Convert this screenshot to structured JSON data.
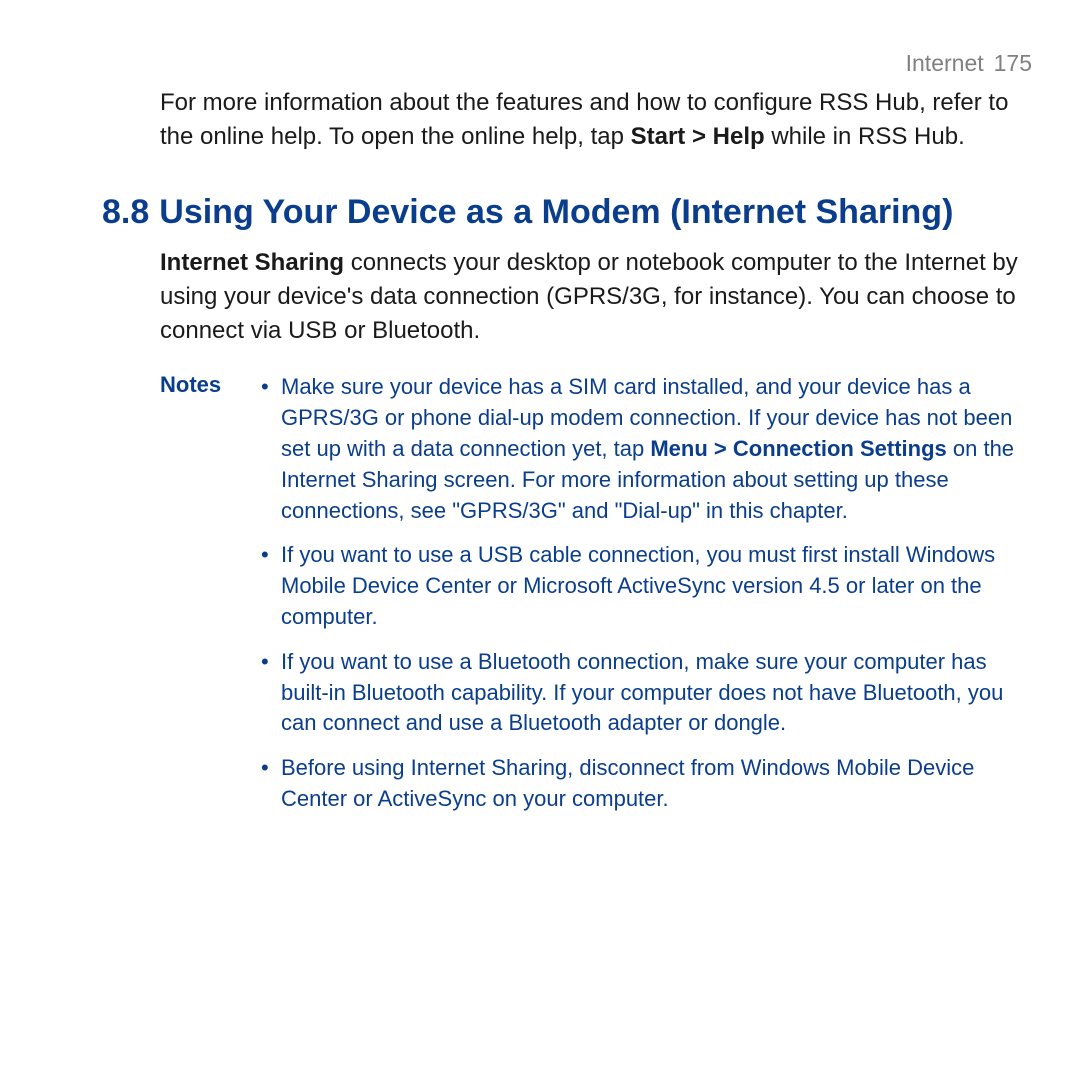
{
  "header": {
    "section": "Internet",
    "page": "175"
  },
  "intro": {
    "pre": "For more information about the features and how to configure RSS Hub, refer to the online help. To open the online help, tap ",
    "bold": "Start > Help",
    "post": " while in RSS Hub."
  },
  "heading": {
    "number": "8.8",
    "title": "Using Your Device as a Modem (Internet Sharing)"
  },
  "body": {
    "lead_bold": "Internet Sharing",
    "lead_rest": " connects your desktop or notebook computer to the Internet by using your device's data connection (GPRS/3G, for instance). You can choose to connect via USB or Bluetooth."
  },
  "notes": {
    "label": "Notes",
    "items": [
      {
        "pre": "Make sure your device has a SIM card installed, and your device has a GPRS/3G or phone dial-up modem connection. If your device has not been set up with a data connection yet, tap ",
        "bold": "Menu > Connection Settings",
        "post": " on the Internet Sharing screen. For more information about setting up these connections, see \"GPRS/3G\" and \"Dial-up\" in this chapter."
      },
      {
        "pre": "If you want to use a USB cable connection, you must first install Windows Mobile Device Center or Microsoft ActiveSync version 4.5 or later on the computer.",
        "bold": "",
        "post": ""
      },
      {
        "pre": "If you want to use a Bluetooth connection, make sure your computer has built-in Bluetooth capability. If your computer does not have Bluetooth, you can connect and use a Bluetooth adapter or dongle.",
        "bold": "",
        "post": ""
      },
      {
        "pre": "Before using Internet Sharing, disconnect from Windows Mobile Device Center or ActiveSync on your computer.",
        "bold": "",
        "post": ""
      }
    ]
  }
}
